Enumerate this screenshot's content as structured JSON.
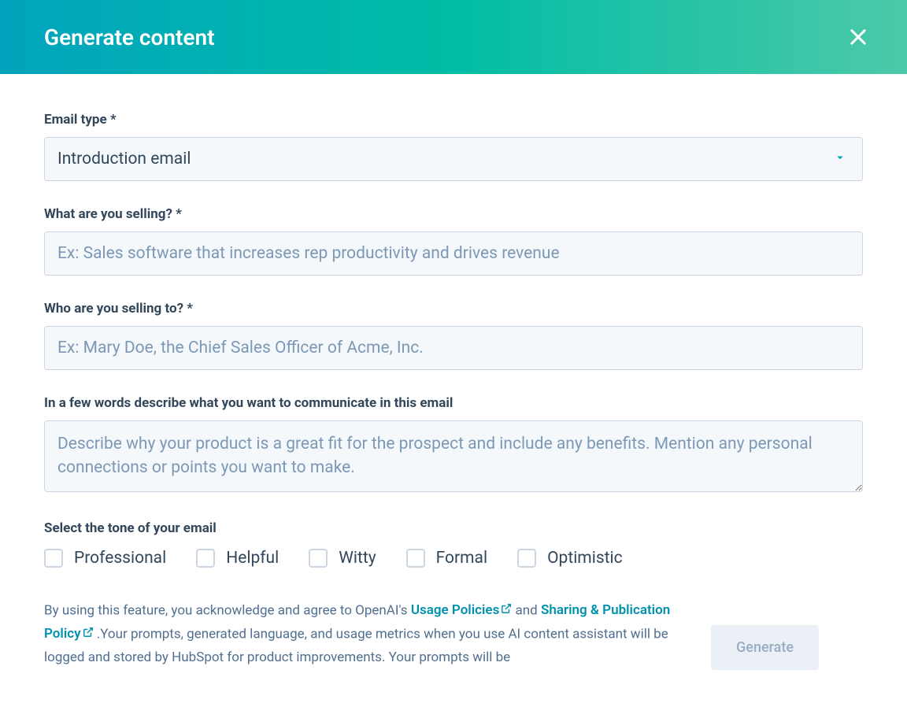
{
  "header": {
    "title": "Generate content"
  },
  "form": {
    "email_type_label": "Email type *",
    "email_type_value": "Introduction email",
    "selling_label": "What are you selling? *",
    "selling_placeholder": "Ex: Sales software that increases rep productivity and drives revenue",
    "selling_to_label": "Who are you selling to? *",
    "selling_to_placeholder": "Ex: Mary Doe, the Chief Sales Officer of Acme, Inc.",
    "describe_label": "In a few words describe what you want to communicate in this email",
    "describe_placeholder": "Describe why your product is a great fit for the prospect and include any benefits. Mention any personal connections or points you want to make.",
    "tone_label": "Select the tone of your email",
    "tones": [
      "Professional",
      "Helpful",
      "Witty",
      "Formal",
      "Optimistic"
    ]
  },
  "disclaimer": {
    "prefix": "By using this feature, you acknowledge and agree to OpenAI's ",
    "link1": "Usage Policies",
    "mid1": "  and ",
    "link2": "Sharing & Publication Policy",
    "suffix": " .Your prompts, generated language, and usage metrics when you use AI content assistant will be logged and stored by HubSpot for product improvements. Your prompts will be"
  },
  "generate_button": "Generate"
}
